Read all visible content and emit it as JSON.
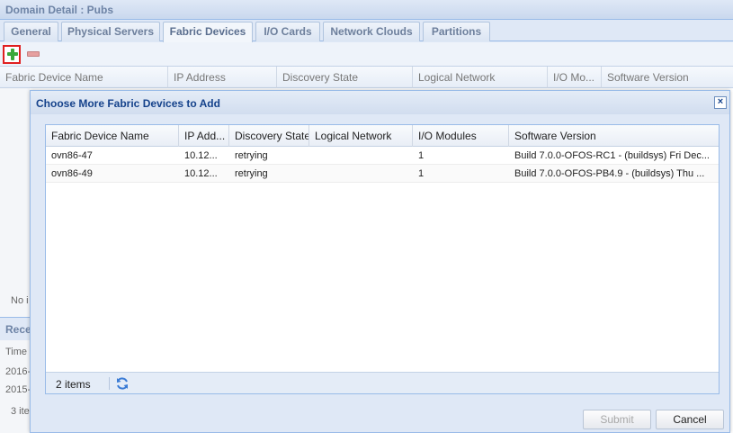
{
  "panel": {
    "title": "Domain Detail : Pubs",
    "tabs": [
      "General",
      "Physical Servers",
      "Fabric Devices",
      "I/O Cards",
      "Network Clouds",
      "Partitions"
    ],
    "active_tab": "Fabric Devices"
  },
  "toolbar": {
    "add_icon": "add-icon",
    "remove_icon": "remove-icon"
  },
  "bg_grid": {
    "columns": [
      "Fabric Device Name",
      "IP Address",
      "Discovery State",
      "Logical Network",
      "I/O Mo...",
      "Software Version"
    ],
    "empty_text": "No i",
    "recent_title": "Rece",
    "recent_col": "Time",
    "recent_rows": [
      "2016-",
      "2015-"
    ],
    "recent_count": "3 ite"
  },
  "dialog": {
    "title": "Choose More Fabric Devices to Add",
    "close_label": "×",
    "columns": [
      "Fabric Device Name",
      "IP Add...",
      "Discovery State",
      "Logical Network",
      "I/O Modules",
      "Software Version"
    ],
    "rows": [
      [
        "ovn86-47",
        "10.12...",
        "retrying",
        "",
        "1",
        "Build 7.0.0-OFOS-RC1 - (buildsys) Fri Dec..."
      ],
      [
        "ovn86-49",
        "10.12...",
        "retrying",
        "",
        "1",
        "Build 7.0.0-OFOS-PB4.9 - (buildsys) Thu ..."
      ]
    ],
    "item_count": "2 items",
    "submit_label": "Submit",
    "cancel_label": "Cancel"
  }
}
